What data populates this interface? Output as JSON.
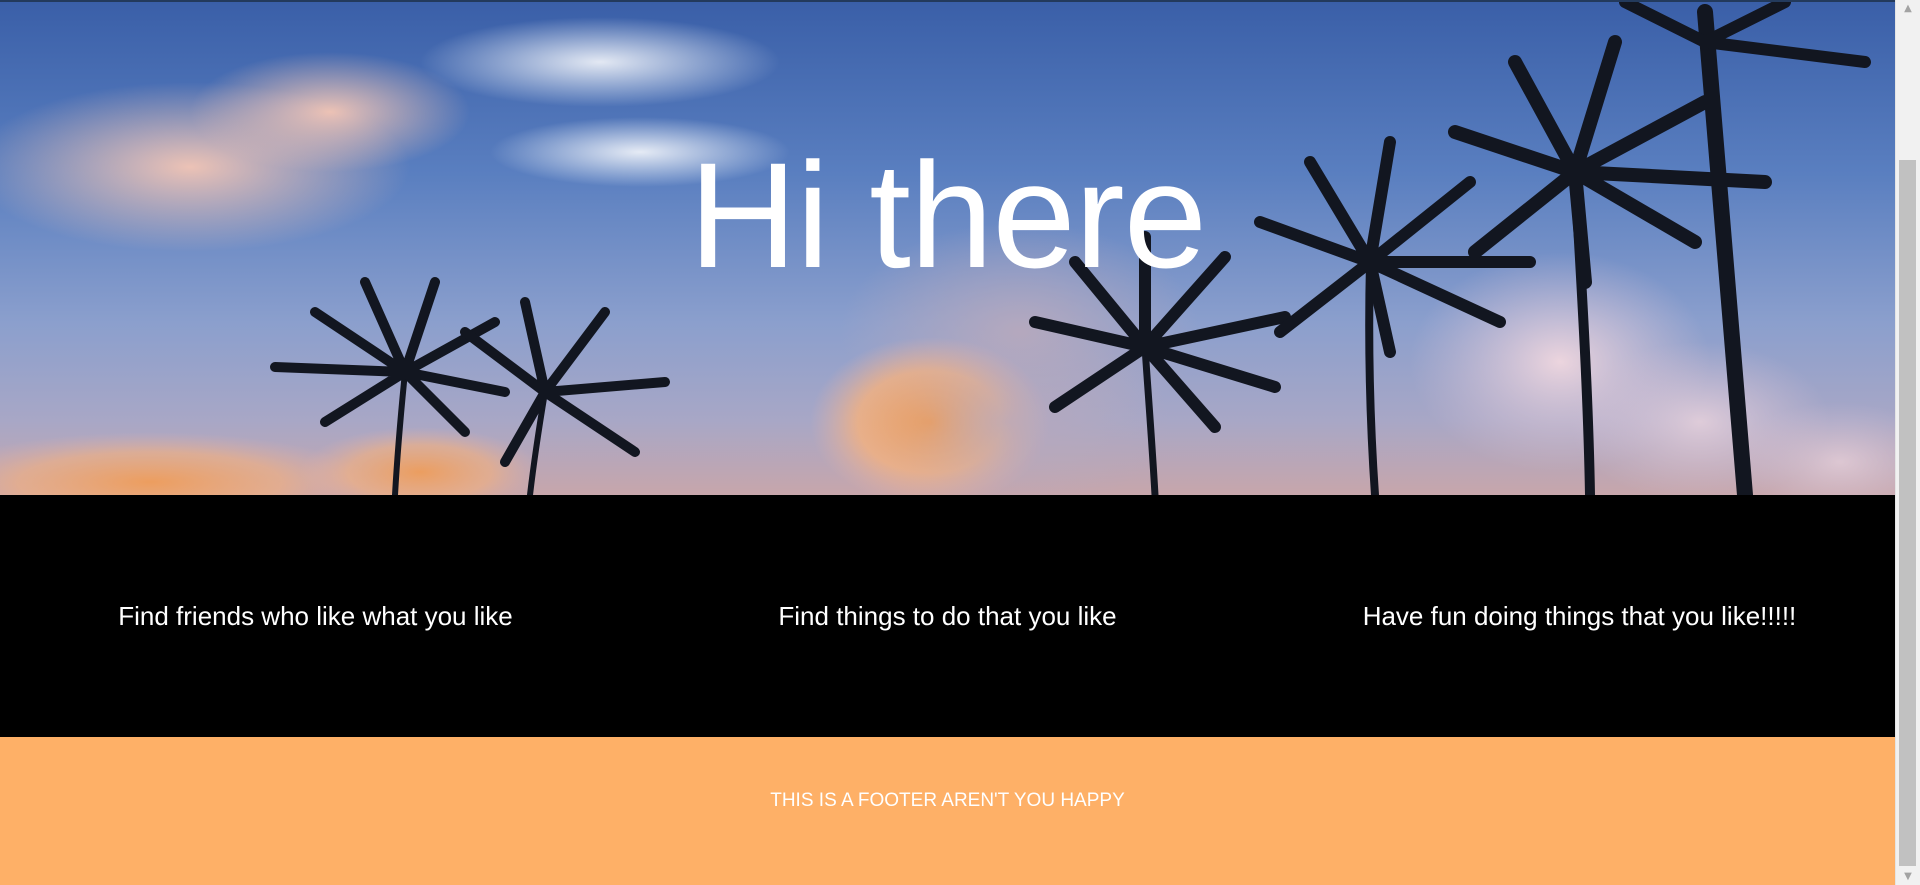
{
  "hero": {
    "title": "Hi there"
  },
  "features": [
    {
      "text": "Find friends who like what you like"
    },
    {
      "text": "Find things to do that you like"
    },
    {
      "text": "Have fun doing things that you like!!!!!"
    }
  ],
  "footer": {
    "text": "THIS IS A FOOTER AREN'T YOU HAPPY"
  },
  "colors": {
    "features_bg": "#000000",
    "footer_bg": "#feb067",
    "text": "#ffffff"
  },
  "icons": {
    "scroll_up": "triangle-up-icon",
    "scroll_down": "triangle-down-icon"
  }
}
